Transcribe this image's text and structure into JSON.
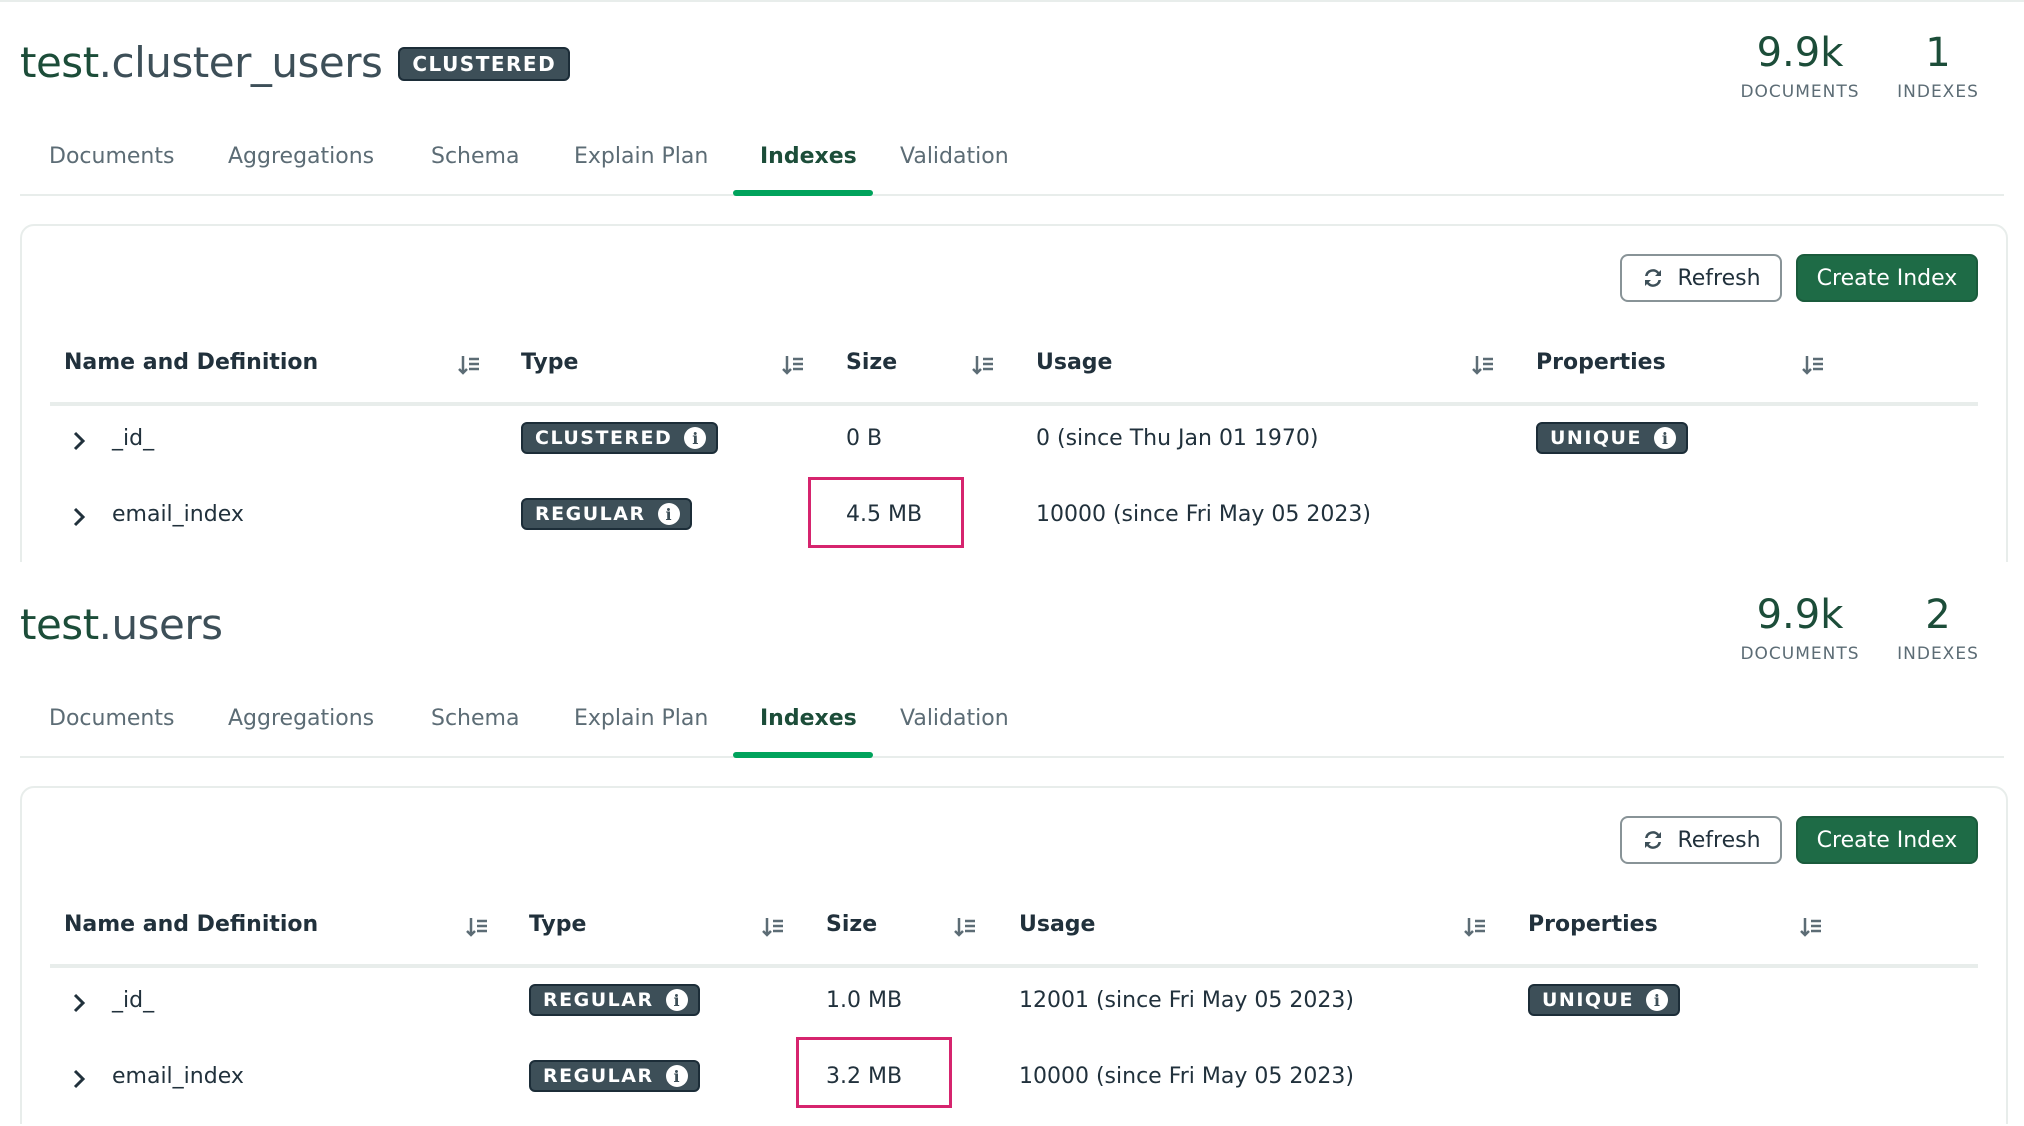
{
  "panels": [
    {
      "db": "test",
      "collection": "cluster_users",
      "badge": "CLUSTERED",
      "stats": [
        {
          "value": "9.9k",
          "label": "DOCUMENTS"
        },
        {
          "value": "1",
          "label": "INDEXES"
        }
      ],
      "tabs": [
        "Documents",
        "Aggregations",
        "Schema",
        "Explain Plan",
        "Indexes",
        "Validation"
      ],
      "active_tab": "Indexes",
      "refresh_label": "Refresh",
      "create_label": "Create Index",
      "columns": [
        "Name and Definition",
        "Type",
        "Size",
        "Usage",
        "Properties"
      ],
      "rows": [
        {
          "name": "_id_",
          "type": "CLUSTERED",
          "size": "0 B",
          "usage": "0 (since Thu Jan 01 1970)",
          "properties": "UNIQUE"
        },
        {
          "name": "email_index",
          "type": "REGULAR",
          "size": "4.5 MB",
          "usage": "10000 (since Fri May 05 2023)",
          "properties": ""
        }
      ]
    },
    {
      "db": "test",
      "collection": "users",
      "badge": "",
      "stats": [
        {
          "value": "9.9k",
          "label": "DOCUMENTS"
        },
        {
          "value": "2",
          "label": "INDEXES"
        }
      ],
      "tabs": [
        "Documents",
        "Aggregations",
        "Schema",
        "Explain Plan",
        "Indexes",
        "Validation"
      ],
      "active_tab": "Indexes",
      "refresh_label": "Refresh",
      "create_label": "Create Index",
      "columns": [
        "Name and Definition",
        "Type",
        "Size",
        "Usage",
        "Properties"
      ],
      "rows": [
        {
          "name": "_id_",
          "type": "REGULAR",
          "size": "1.0 MB",
          "usage": "12001 (since Fri May 05 2023)",
          "properties": "UNIQUE"
        },
        {
          "name": "email_index",
          "type": "REGULAR",
          "size": "3.2 MB",
          "usage": "10000 (since Fri May 05 2023)",
          "properties": ""
        }
      ]
    }
  ],
  "icons": {
    "refresh": "refresh-icon",
    "sort": "sort-icon",
    "expand": "chevron-right-icon",
    "info": "info-icon"
  },
  "colors": {
    "brand_green": "#1c4d39",
    "active_tab_underline": "#00a35c",
    "badge_bg": "#3d4f58",
    "highlight_border": "#d6246e"
  }
}
